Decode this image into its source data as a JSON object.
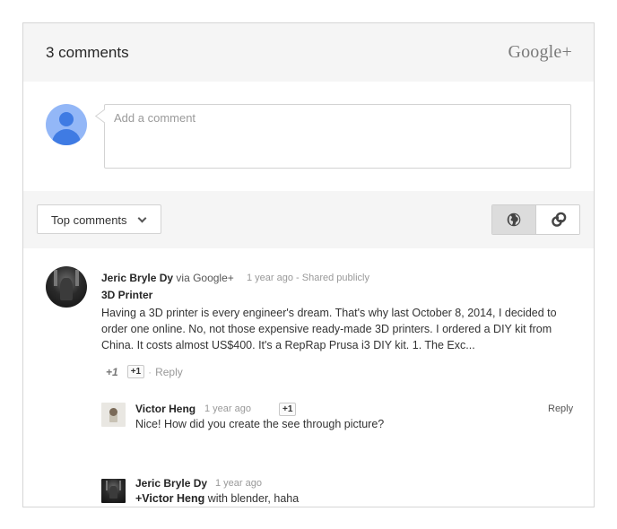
{
  "header": {
    "comment_count_label": "3 comments",
    "brand_label": "Google+"
  },
  "compose": {
    "placeholder": "Add a comment"
  },
  "toolbar": {
    "sort_label": "Top comments",
    "view_toggle": [
      {
        "icon": "globe-icon",
        "selected": true
      },
      {
        "icon": "link-icon",
        "selected": false
      }
    ]
  },
  "post": {
    "author": "Jeric Bryle Dy",
    "via": "via Google+",
    "time": "1 year ago",
    "separator": "-",
    "visibility": "Shared publicly",
    "title": "3D Printer",
    "body": "Having a 3D printer is every engineer's dream. That's why last October 8, 2014, I decided to order one online. No, not those expensive ready-made 3D printers. I ordered a DIY kit from China. It costs almost US$400. It's a RepRap Prusa i3 DIY kit. 1. The Exc...",
    "plus_count": "+1",
    "plus_button": "+1",
    "separator2": "·",
    "reply_label": "Reply"
  },
  "replies": [
    {
      "author": "Victor Heng",
      "time": "1 year ago",
      "plus_button": "+1",
      "text": "Nice! How did you create the see through picture?",
      "reply_label": "Reply"
    },
    {
      "author": "Jeric Bryle Dy",
      "time": "1 year ago",
      "mention": "+Victor Heng",
      "text": " with blender, haha"
    }
  ],
  "colors": {
    "header_bg": "#f5f5f5",
    "avatar_accent": "#3f7be3",
    "avatar_bg": "#93b7f7",
    "toggle_selected": "#dcdcdc"
  }
}
